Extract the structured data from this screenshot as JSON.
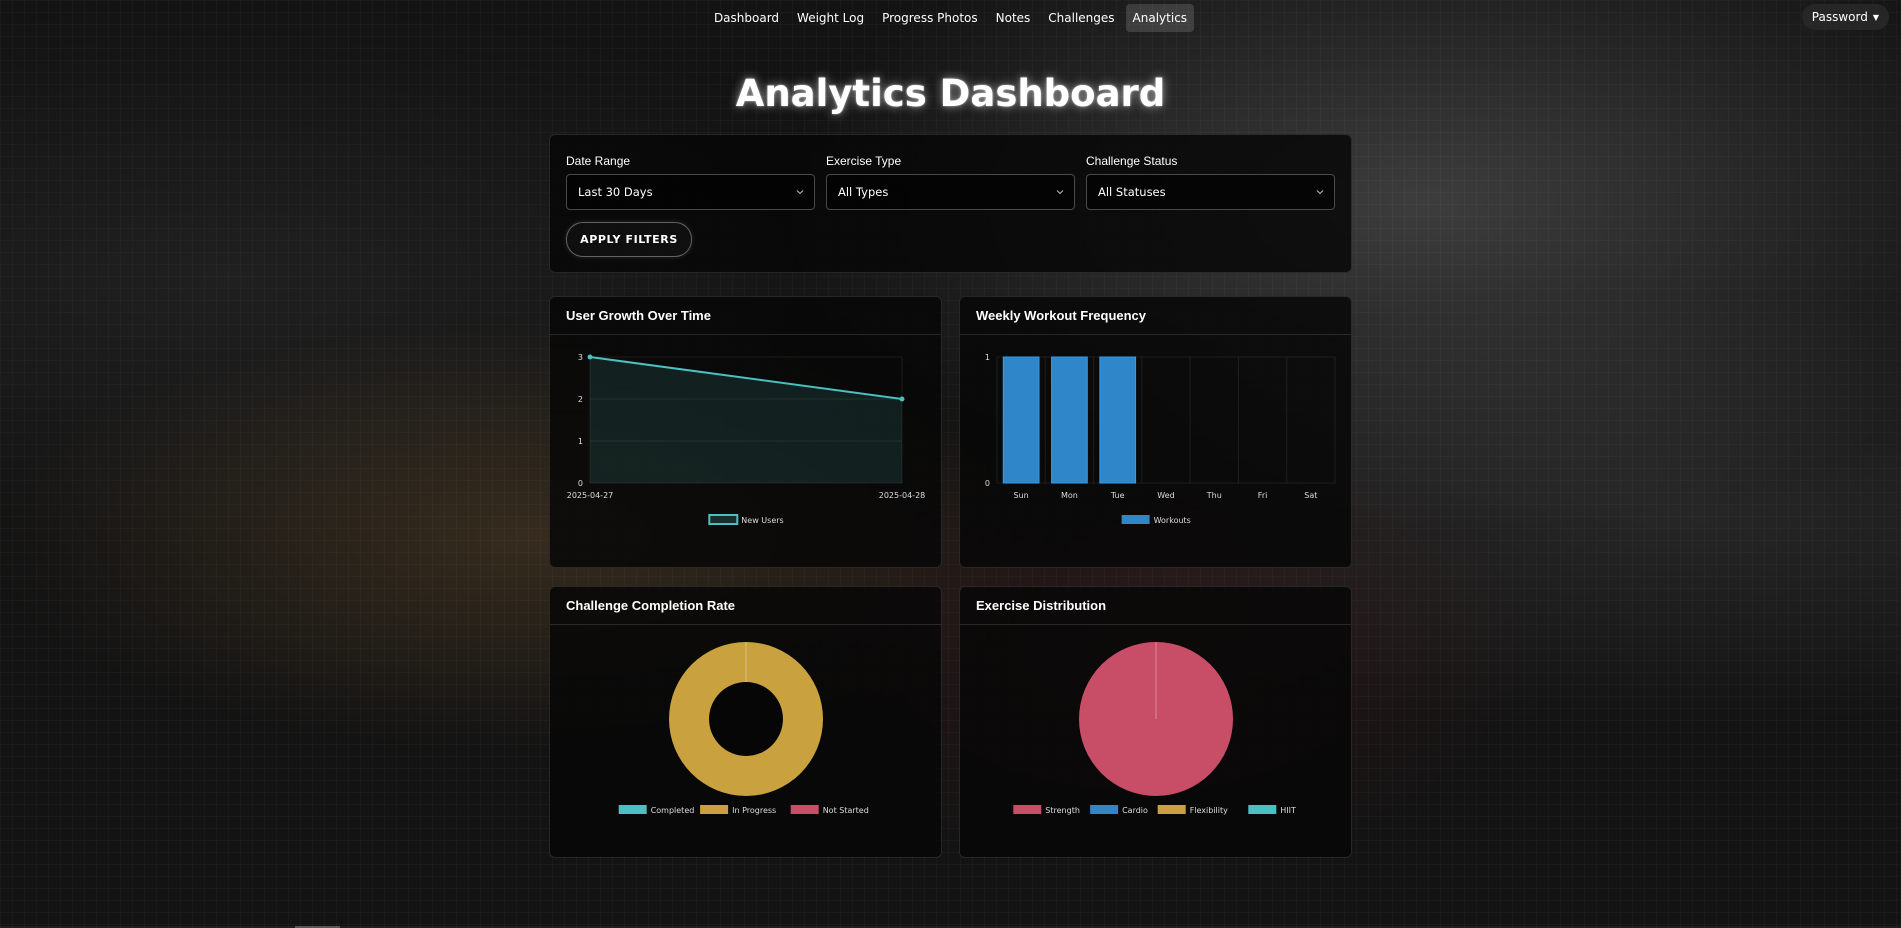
{
  "nav": {
    "links": [
      "Dashboard",
      "Weight Log",
      "Progress Photos",
      "Notes",
      "Challenges",
      "Analytics"
    ],
    "active": "Analytics",
    "user_menu_label": "Password"
  },
  "page_title": "Analytics Dashboard",
  "filters": {
    "date_range": {
      "label": "Date Range",
      "value": "Last 30 Days"
    },
    "exercise_type": {
      "label": "Exercise Type",
      "value": "All Types"
    },
    "challenge_status": {
      "label": "Challenge Status",
      "value": "All Statuses"
    },
    "apply_label": "APPLY FILTERS"
  },
  "colors": {
    "teal": "#4bc0c0",
    "blue": "#2f86c9",
    "gold": "#c9a23f",
    "red": "#c84d66"
  },
  "cards": {
    "user_growth": {
      "title": "User Growth Over Time"
    },
    "weekly_freq": {
      "title": "Weekly Workout Frequency"
    },
    "completion": {
      "title": "Challenge Completion Rate"
    },
    "distribution": {
      "title": "Exercise Distribution"
    }
  },
  "chart_data": [
    {
      "id": "user_growth",
      "type": "line",
      "title": "User Growth Over Time",
      "x": [
        "2025-04-27",
        "2025-04-28"
      ],
      "series": [
        {
          "name": "New Users",
          "values": [
            3,
            2
          ],
          "color": "#4bc0c0",
          "fill": true
        }
      ],
      "ylim": [
        0,
        3
      ],
      "yticks": [
        0,
        1,
        2,
        3
      ],
      "legend": "bottom",
      "grid": true
    },
    {
      "id": "weekly_freq",
      "type": "bar",
      "title": "Weekly Workout Frequency",
      "categories": [
        "Sun",
        "Mon",
        "Tue",
        "Wed",
        "Thu",
        "Fri",
        "Sat"
      ],
      "series": [
        {
          "name": "Workouts",
          "values": [
            1,
            1,
            1,
            0,
            0,
            0,
            0
          ],
          "color": "#2f86c9"
        }
      ],
      "ylim": [
        0,
        1
      ],
      "yticks": [
        0,
        1
      ],
      "legend": "bottom",
      "grid": true
    },
    {
      "id": "completion",
      "type": "pie",
      "variant": "doughnut",
      "title": "Challenge Completion Rate",
      "labels": [
        "Completed",
        "In Progress",
        "Not Started"
      ],
      "values": [
        0,
        1,
        0
      ],
      "colors": [
        "#4bc0c0",
        "#c9a23f",
        "#c84d66"
      ],
      "legend": "bottom"
    },
    {
      "id": "distribution",
      "type": "pie",
      "title": "Exercise Distribution",
      "labels": [
        "Strength",
        "Cardio",
        "Flexibility",
        "HIIT"
      ],
      "values": [
        1,
        0,
        0,
        0
      ],
      "colors": [
        "#c84d66",
        "#2f86c9",
        "#c9a23f",
        "#4bc0c0"
      ],
      "legend": "bottom"
    }
  ]
}
